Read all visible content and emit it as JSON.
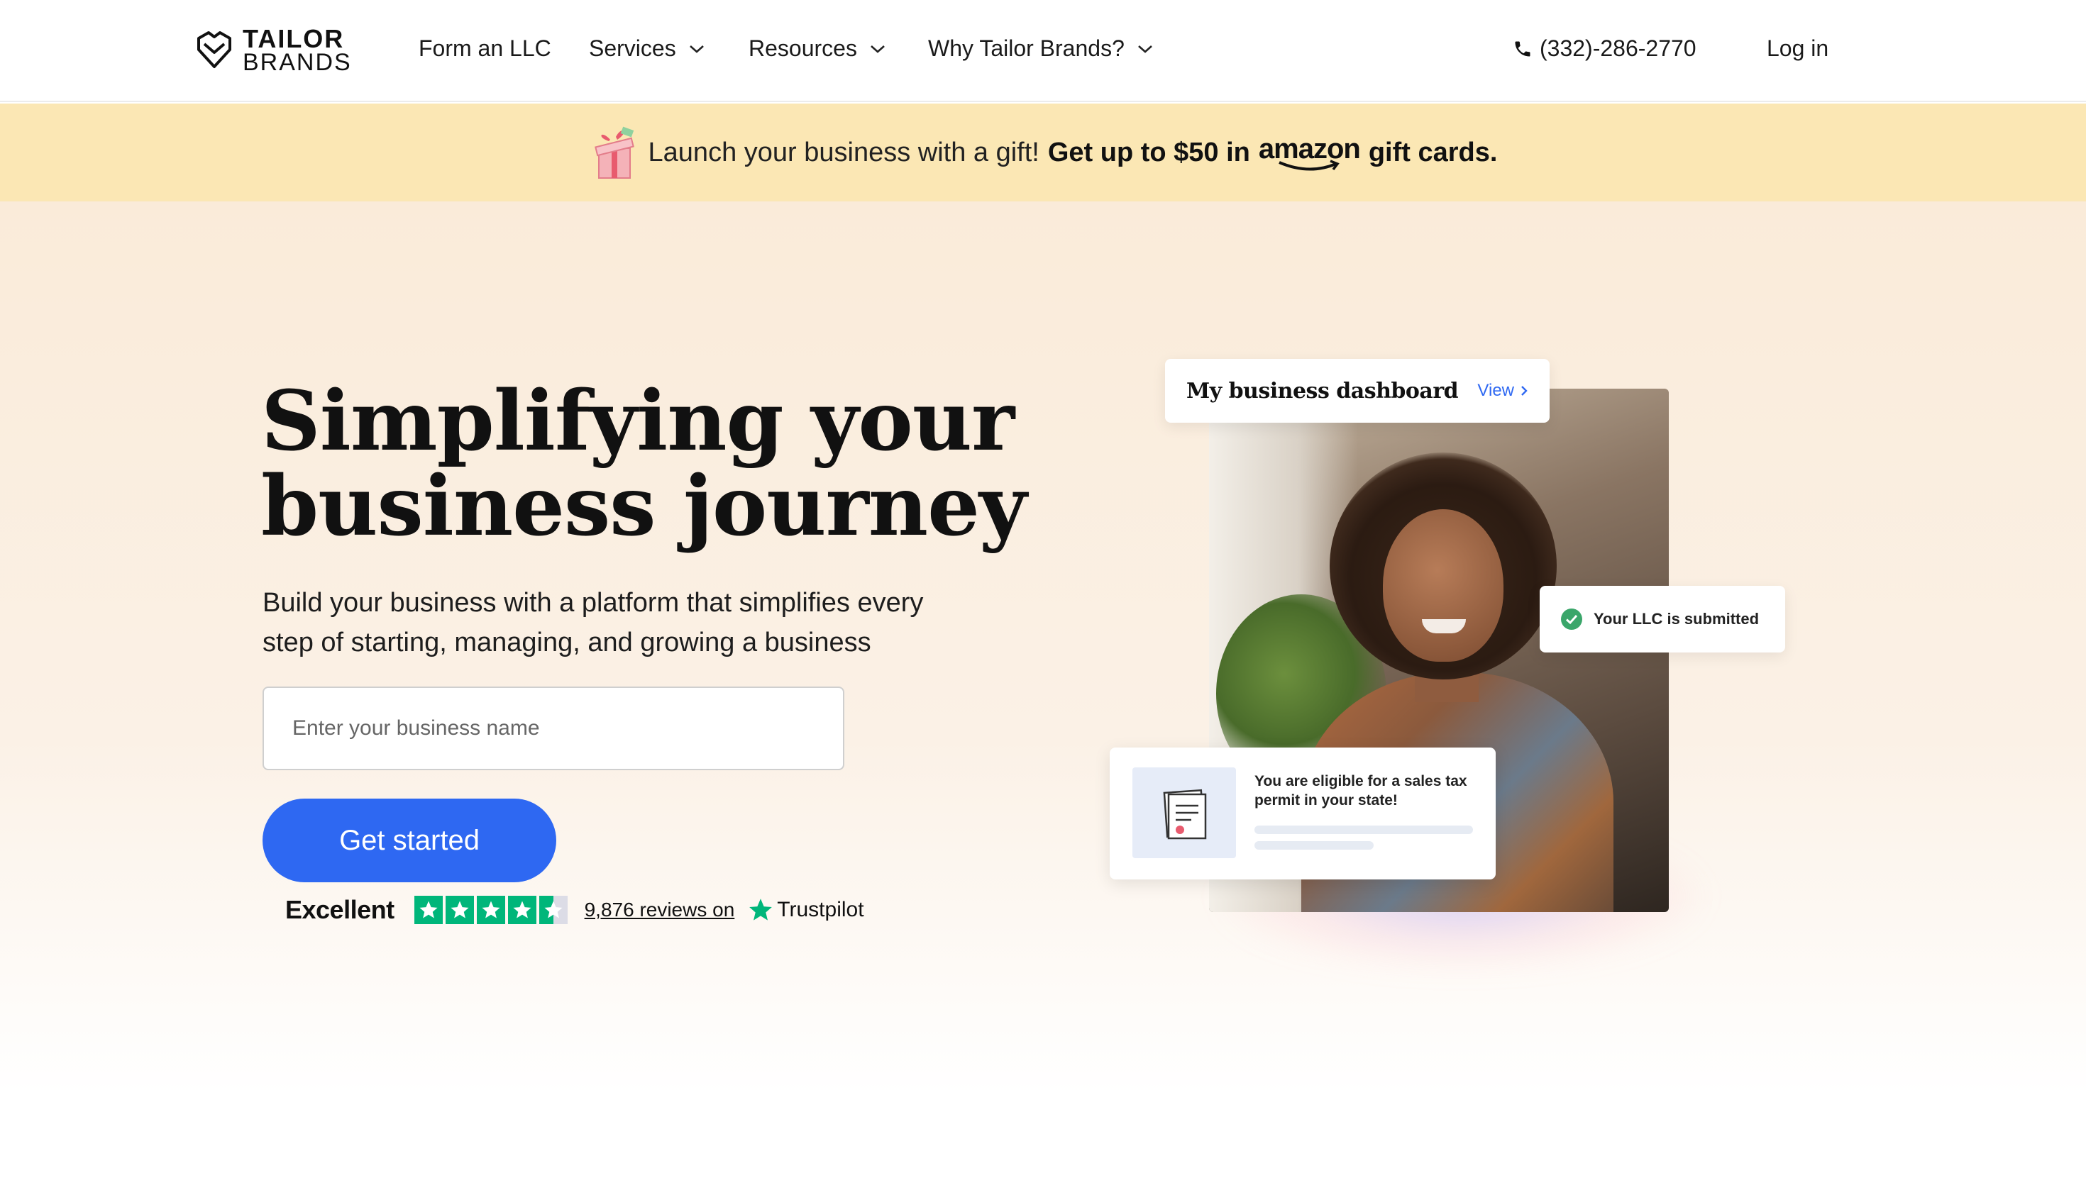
{
  "nav": {
    "logo": {
      "line1": "TAILOR",
      "line2": "BRANDS"
    },
    "items": [
      {
        "label": "Form an LLC",
        "has_dropdown": false
      },
      {
        "label": "Services",
        "has_dropdown": true
      },
      {
        "label": "Resources",
        "has_dropdown": true
      },
      {
        "label": "Why Tailor Brands?",
        "has_dropdown": true
      }
    ],
    "phone": "(332)-286-2770",
    "login": "Log in"
  },
  "promo": {
    "text": "Launch your business with a gift!",
    "bold_text": "Get up to $50 in",
    "brand": "amazon",
    "suffix": "gift cards."
  },
  "hero": {
    "title_line1": "Simplifying your",
    "title_line2": "business journey",
    "subtitle": "Build your business with a platform that simplifies every step of starting, managing, and growing a business",
    "input_placeholder": "Enter your business name",
    "cta_label": "Get started",
    "trustpilot": {
      "rating_text": "Excellent",
      "stars": 4.5,
      "reviews_text": "9,876 reviews on",
      "brand": "Trustpilot"
    }
  },
  "visual": {
    "dashboard_title": "My business dashboard",
    "dashboard_view": "View",
    "llc_status": "Your LLC is submitted",
    "tax_message": "You are eligible for a sales tax permit in your state!"
  },
  "colors": {
    "accent": "#2e68f2",
    "promo_bg": "#fbe7b4",
    "hero_bg": "#faebd9",
    "trustpilot_green": "#00b67a",
    "success": "#3aa66a"
  },
  "icons": [
    "tailor-brands-logo-icon",
    "chevron-down-icon",
    "phone-icon",
    "gift-icon",
    "star-icon",
    "check-circle-icon",
    "chevron-right-icon",
    "document-icon"
  ]
}
